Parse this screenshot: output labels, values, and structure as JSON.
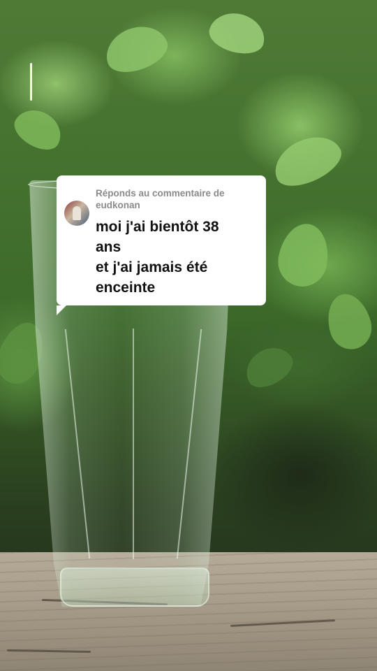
{
  "comment_sticker": {
    "reply_prefix": "Réponds au commentaire de",
    "username": "eudkonan",
    "text_lines": [
      "moi j'ai bientôt 38",
      "ans",
      "et j'ai jamais été",
      "enceinte"
    ]
  },
  "icons": {
    "avatar": "user-avatar"
  }
}
